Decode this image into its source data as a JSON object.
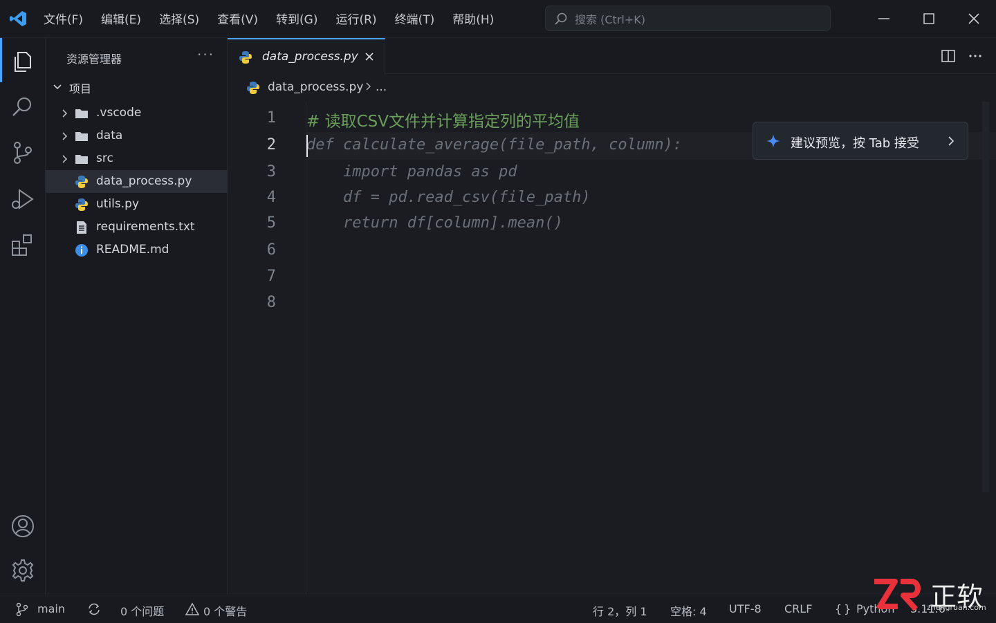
{
  "menu": [
    "文件(F)",
    "编辑(E)",
    "选择(S)",
    "查看(V)",
    "转到(G)",
    "运行(R)",
    "终端(T)",
    "帮助(H)"
  ],
  "search": {
    "placeholder": "搜索 (Ctrl+K)"
  },
  "sidebar": {
    "title": "资源管理器",
    "more": "···",
    "project": "项目",
    "items": [
      {
        "label": ".vscode",
        "type": "folder"
      },
      {
        "label": "data",
        "type": "folder"
      },
      {
        "label": "src",
        "type": "folder"
      },
      {
        "label": "data_process.py",
        "type": "python",
        "selected": true
      },
      {
        "label": "utils.py",
        "type": "python"
      },
      {
        "label": "requirements.txt",
        "type": "text"
      },
      {
        "label": "README.md",
        "type": "info"
      }
    ]
  },
  "editor": {
    "tab_label": "data_process.py",
    "breadcrumb_file": "data_process.py",
    "breadcrumb_more": "...",
    "line_numbers": [
      "1",
      "2",
      "3",
      "4",
      "5",
      "6",
      "7",
      "8"
    ],
    "lines": [
      "# 读取CSV文件并计算指定列的平均值",
      "def calculate_average(file_path, column):",
      "    import pandas as pd",
      "    df = pd.read_csv(file_path)",
      "    return df[column].mean()"
    ],
    "suggestion": "建议预览，按 Tab 接受"
  },
  "status": {
    "branch": "main",
    "problems": "0 个问题",
    "warnings": "0 个警告",
    "position": "行 2，列 1",
    "spaces": "空格: 4",
    "encoding": "UTF-8",
    "eol": "CRLF",
    "language": "Python",
    "version": "3.11.6"
  },
  "watermark": {
    "text": "正软",
    "url": "zhengruan.com"
  },
  "colors": {
    "accent": "#4aa3ff",
    "comment": "#6a9e5a",
    "ghost": "#6a6f78",
    "background": "#181a1f"
  }
}
